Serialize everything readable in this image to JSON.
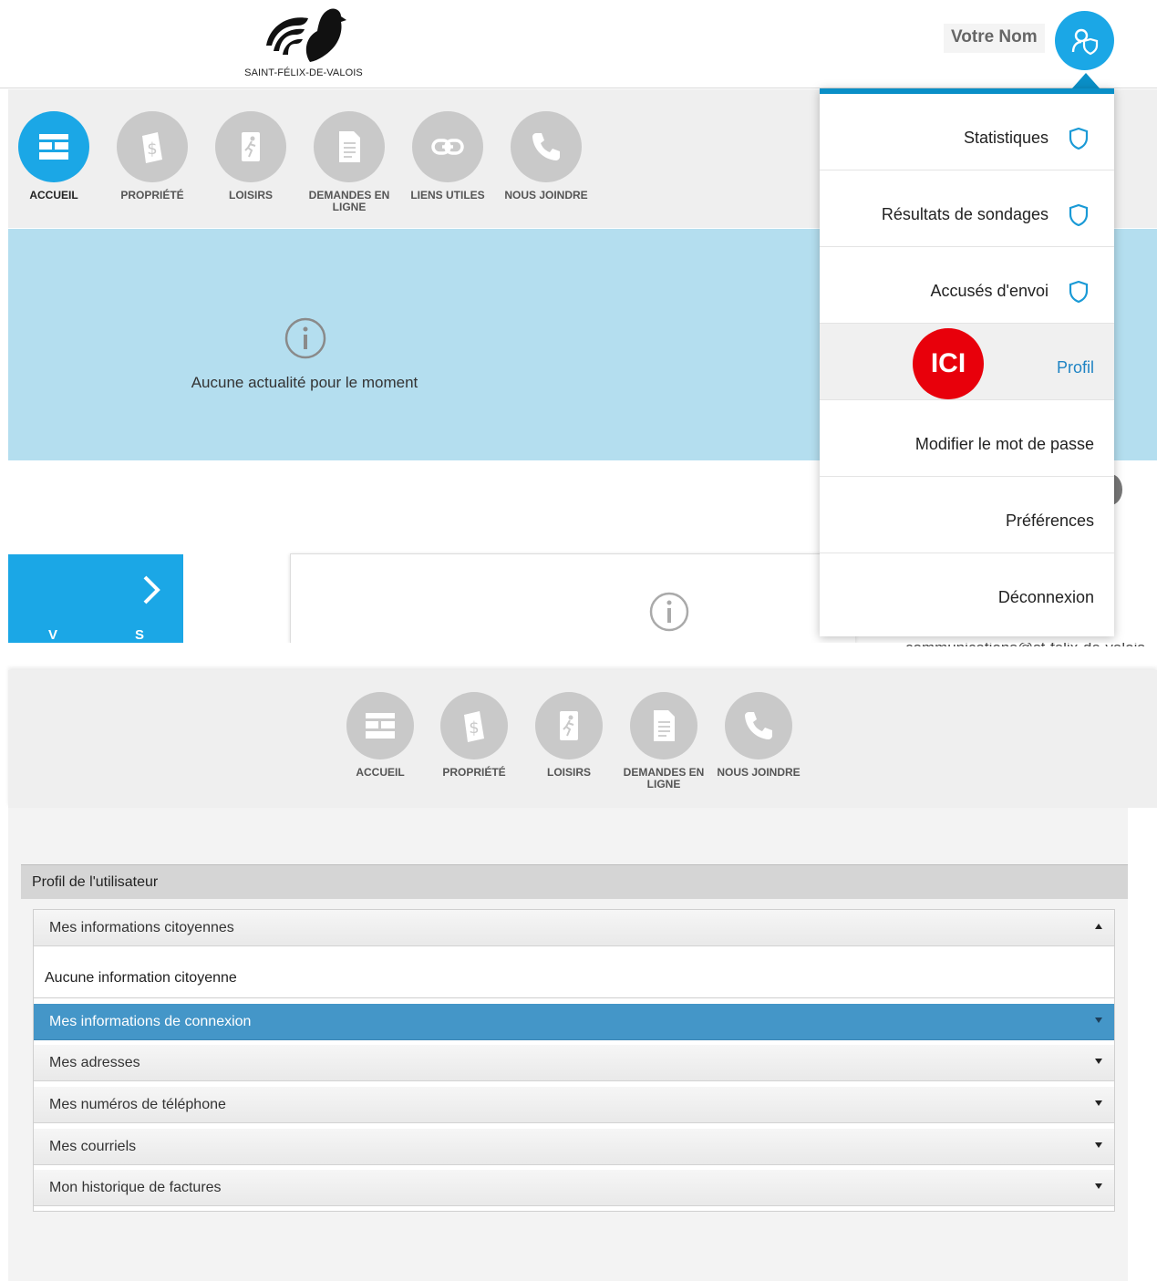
{
  "header": {
    "logo_text": "SAINT-FÉLIX-DE-VALOIS",
    "user_name": "Votre Nom"
  },
  "nav_top": [
    {
      "label": "ACCUEIL",
      "icon": "home-grid-icon",
      "active": true
    },
    {
      "label": "PROPRIÉTÉ",
      "icon": "dollar-tag-icon",
      "active": false
    },
    {
      "label": "LOISIRS",
      "icon": "running-person-icon",
      "active": false
    },
    {
      "label": "DEMANDES EN LIGNE",
      "icon": "document-icon",
      "active": false
    },
    {
      "label": "LIENS UTILES",
      "icon": "link-icon",
      "active": false
    },
    {
      "label": "NOUS JOINDRE",
      "icon": "phone-icon",
      "active": false
    }
  ],
  "news": {
    "empty_text": "Aucune actualité pour le moment"
  },
  "tile": {
    "left_letter": "V",
    "right_letter": "S"
  },
  "menu": {
    "items": [
      {
        "label": "Statistiques",
        "icon": "shield-icon"
      },
      {
        "label": "Résultats de sondages",
        "icon": "shield-icon"
      },
      {
        "label": "Accusés d'envoi",
        "icon": "shield-icon"
      },
      {
        "label": "Profil",
        "highlight": true
      },
      {
        "label": "Modifier le mot de passe"
      },
      {
        "label": "Préférences"
      },
      {
        "label": "Déconnexion"
      }
    ],
    "badge": "ICI"
  },
  "bottom": {
    "partial_email": "communications@st-felix-de-valois",
    "nav": [
      {
        "label": "ACCUEIL",
        "icon": "home-grid-icon"
      },
      {
        "label": "PROPRIÉTÉ",
        "icon": "dollar-tag-icon"
      },
      {
        "label": "LOISIRS",
        "icon": "running-person-icon"
      },
      {
        "label": "DEMANDES EN LIGNE",
        "icon": "document-icon"
      },
      {
        "label": "NOUS JOINDRE",
        "icon": "phone-icon"
      }
    ],
    "profile_title": "Profil de l'utilisateur",
    "sections": [
      {
        "label": "Mes informations citoyennes",
        "open": true
      },
      {
        "label": "Mes informations de connexion",
        "active": true
      },
      {
        "label": "Mes adresses"
      },
      {
        "label": "Mes numéros de téléphone"
      },
      {
        "label": "Mes courriels"
      },
      {
        "label": "Mon historique de factures"
      }
    ],
    "citizen_info_empty": "Aucune information citoyenne"
  },
  "colors": {
    "primary_blue": "#1ba7e6",
    "menu_accent": "#0a8fc7",
    "active_row": "#4496c8",
    "badge_red": "#e8000b",
    "news_band": "#b4deef"
  }
}
